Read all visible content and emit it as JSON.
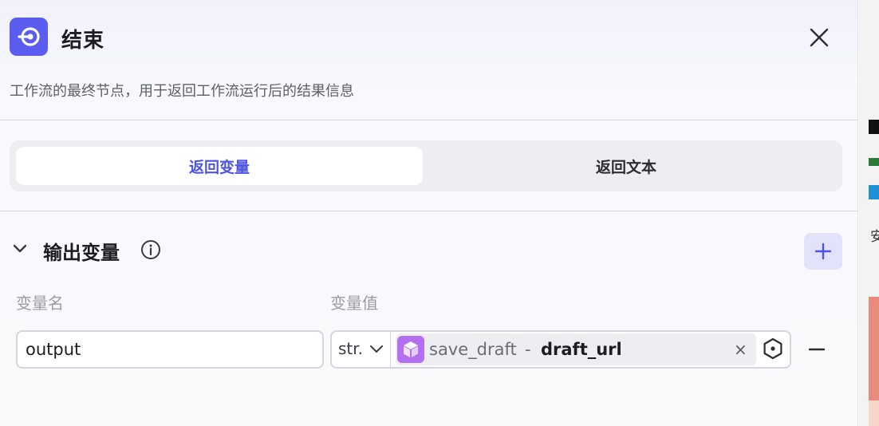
{
  "header": {
    "title": "结束",
    "description": "工作流的最终节点，用于返回工作流运行后的结果信息",
    "accent_color": "#5b5cf0"
  },
  "tabs": [
    {
      "label": "返回变量",
      "active": true
    },
    {
      "label": "返回文本",
      "active": false
    }
  ],
  "output_section": {
    "title": "输出变量",
    "columns": {
      "name": "变量名",
      "value": "变量值"
    },
    "rows": [
      {
        "name": "output",
        "type": "str.",
        "ref_node": "save_draft",
        "ref_separator": "-",
        "ref_variable": "draft_url",
        "clear_glyph": "×"
      }
    ]
  },
  "right_strip": {
    "fragment_text": "安"
  },
  "icons": [
    "end-node-icon",
    "close-icon",
    "chevron-down-icon",
    "info-icon",
    "plus-icon",
    "cube-icon",
    "variable-picker-icon",
    "minus-icon"
  ]
}
